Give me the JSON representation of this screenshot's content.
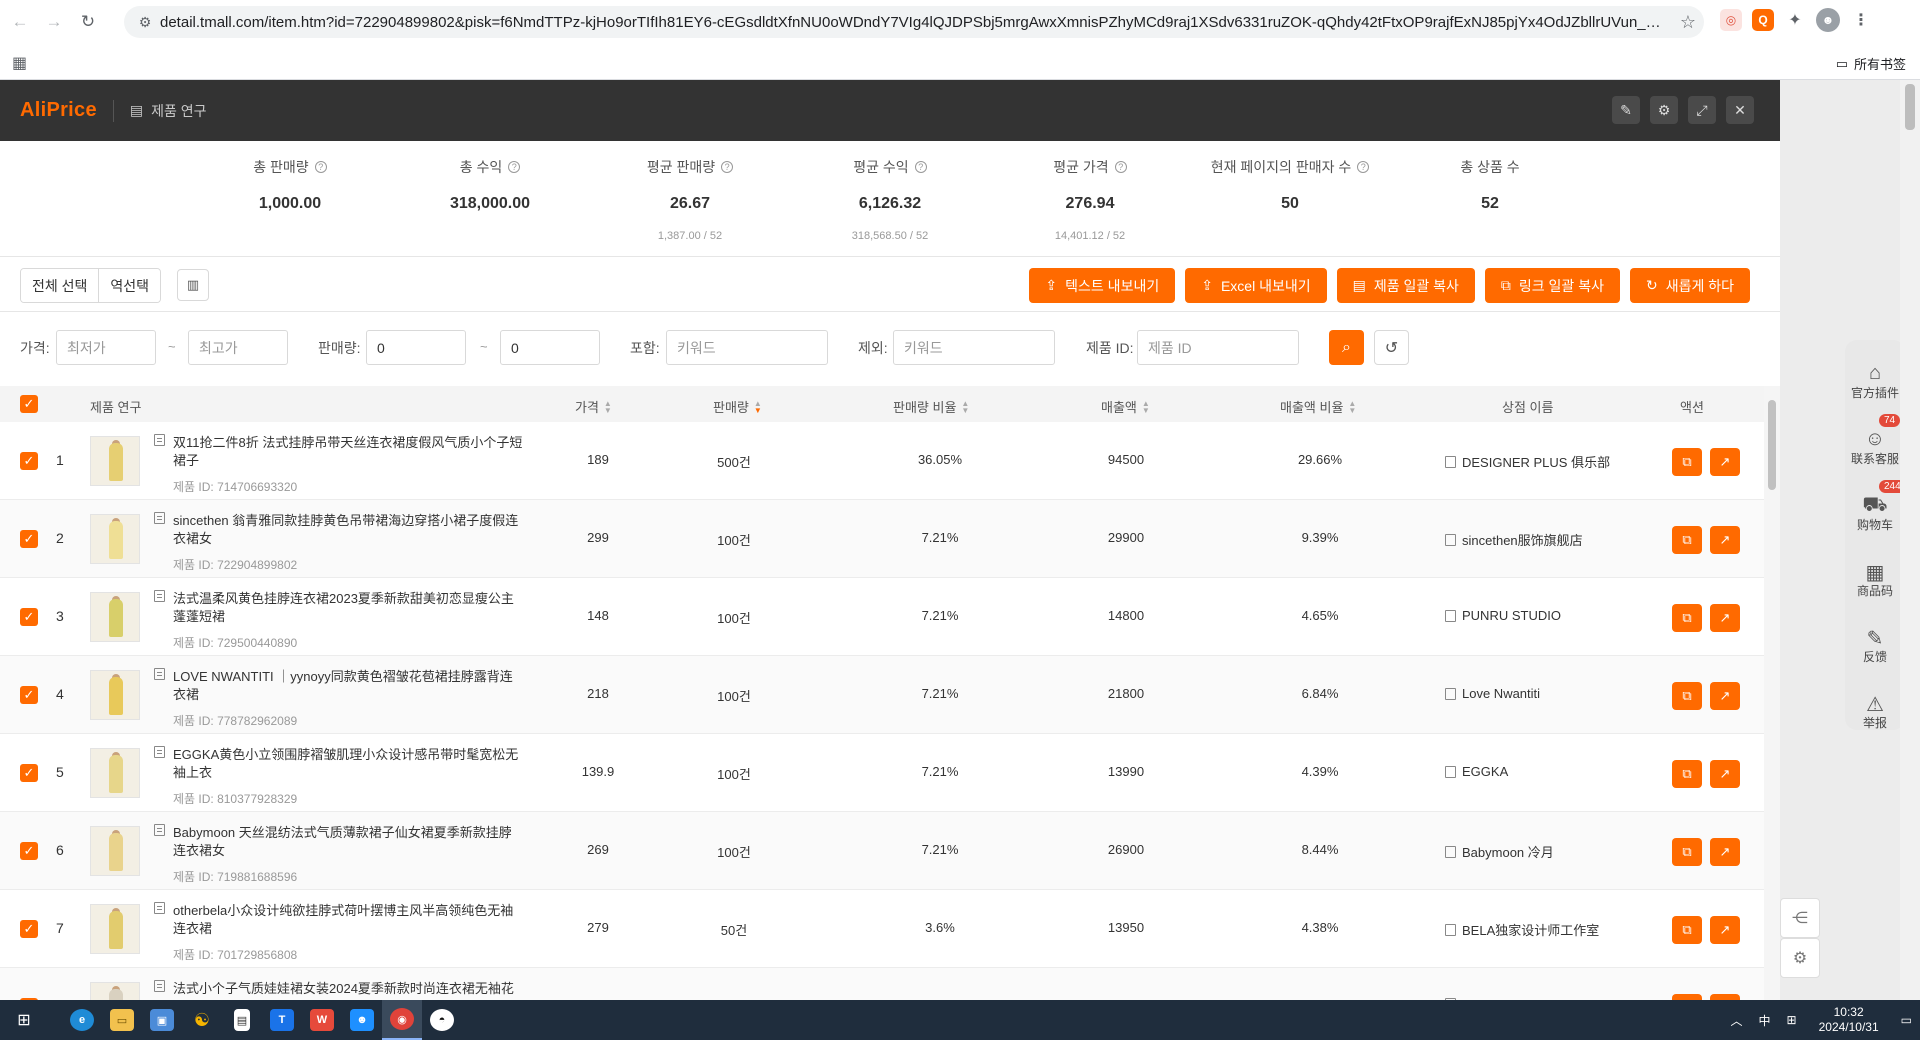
{
  "browser": {
    "url": "detail.tmall.com/item.htm?id=722904899802&pisk=f6NmdTTPz-kjHo9orTIfIh81EY6-cEGsdldtXfnNU0oWDndY7VIg4lQJDPSbj5mrgAwxXmnisPZhyMCd9raj1XSdv6331ruZOK-qQhdy42tFtxOP9rajfExNJ85pjYx4OdJZbllrUVun_Vo...",
    "bookmarks_all": "所有书签"
  },
  "plugin": {
    "logo": "AliPrice",
    "title": "제품 연구"
  },
  "stats": [
    {
      "label": "총 판매량",
      "value": "1,000.00",
      "sub": ""
    },
    {
      "label": "총 수익",
      "value": "318,000.00",
      "sub": ""
    },
    {
      "label": "평균 판매량",
      "value": "26.67",
      "sub": "1,387.00 / 52"
    },
    {
      "label": "평균 수익",
      "value": "6,126.32",
      "sub": "318,568.50 / 52"
    },
    {
      "label": "평균 가격",
      "value": "276.94",
      "sub": "14,401.12 / 52"
    },
    {
      "label": "현재 페이지의 판매자 수",
      "value": "50",
      "sub": ""
    },
    {
      "label": "총 상품 수",
      "value": "52",
      "sub": ""
    }
  ],
  "actions": {
    "select_all": "전체 선택",
    "invert": "역선택",
    "export_text": "텍스트 내보내기",
    "export_excel": "Excel 내보내기",
    "copy_products": "제품 일괄 복사",
    "copy_links": "링크 일괄 복사",
    "refresh": "새롭게 하다"
  },
  "filters": {
    "price_label": "가격:",
    "price_min": "최저가",
    "price_max": "최고가",
    "sales_label": "판매량:",
    "sales_min": "0",
    "sales_max": "0",
    "include_label": "포함:",
    "include_ph": "키워드",
    "exclude_label": "제외:",
    "exclude_ph": "키워드",
    "pid_label": "제품 ID:",
    "pid_ph": "제품 ID",
    "tilde": "~"
  },
  "table": {
    "headers": {
      "product": "제품 연구",
      "price": "가격",
      "sales": "판매량",
      "sales_ratio": "판매량 비율",
      "revenue": "매출액",
      "revenue_ratio": "매출액 비율",
      "shop": "상점 이름",
      "action": "액션"
    },
    "id_prefix": "제품 ID: ",
    "rows": [
      {
        "no": "1",
        "name": "双11抢二件8折 法式挂脖吊带天丝连衣裙度假风气质小个子短裙子",
        "pid": "제품 ID: 714706693320",
        "price": "189",
        "sales": "500건",
        "sales_ratio": "36.05%",
        "revenue": "94500",
        "revenue_ratio": "29.66%",
        "shop": "DESIGNER PLUS 俱乐部",
        "color": "#e6cf72"
      },
      {
        "no": "2",
        "name": "sincethen 翁青雅同款挂脖黄色吊带裙海边穿搭小裙子度假连衣裙女",
        "pid": "제품 ID: 722904899802",
        "price": "299",
        "sales": "100건",
        "sales_ratio": "7.21%",
        "revenue": "29900",
        "revenue_ratio": "9.39%",
        "shop": "sincethen服饰旗舰店",
        "color": "#efdf95"
      },
      {
        "no": "3",
        "name": "法式温柔风黄色挂脖连衣裙2023夏季新款甜美初恋显瘦公主蓬蓬短裙",
        "pid": "제품 ID: 729500440890",
        "price": "148",
        "sales": "100건",
        "sales_ratio": "7.21%",
        "revenue": "14800",
        "revenue_ratio": "4.65%",
        "shop": "PUNRU STUDIO",
        "color": "#d8cf6a"
      },
      {
        "no": "4",
        "name": "LOVE NWANTITI ｜yynoyy同款黄色褶皱花苞裙挂脖露背连衣裙",
        "pid": "제품 ID: 778782962089",
        "price": "218",
        "sales": "100건",
        "sales_ratio": "7.21%",
        "revenue": "21800",
        "revenue_ratio": "6.84%",
        "shop": "Love Nwantiti",
        "color": "#e8c95a"
      },
      {
        "no": "5",
        "name": "EGGKA黄色小立领围脖褶皱肌理小众设计感吊带时髦宽松无袖上衣",
        "pid": "제품 ID: 810377928329",
        "price": "139.9",
        "sales": "100건",
        "sales_ratio": "7.21%",
        "revenue": "13990",
        "revenue_ratio": "4.39%",
        "shop": "EGGKA",
        "color": "#e7d68a"
      },
      {
        "no": "6",
        "name": "Babymoon 天丝混纺法式气质薄款裙子仙女裙夏季新款挂脖连衣裙女",
        "pid": "제품 ID: 719881688596",
        "price": "269",
        "sales": "100건",
        "sales_ratio": "7.21%",
        "revenue": "26900",
        "revenue_ratio": "8.44%",
        "shop": "Babymoon 冷月",
        "color": "#e9d38c"
      },
      {
        "no": "7",
        "name": "otherbela小众设计纯欲挂脖式荷叶摆博主风半高领纯色无袖连衣裙",
        "pid": "제품 ID: 701729856808",
        "price": "279",
        "sales": "50건",
        "sales_ratio": "3.6%",
        "revenue": "13950",
        "revenue_ratio": "4.38%",
        "shop": "BELA独家设计师工作室",
        "color": "#e2cc6e"
      },
      {
        "no": "8",
        "name": "法式小个子气质娃娃裙女装2024夏季新款时尚连衣裙无袖花",
        "pid": "",
        "price": "",
        "sales": "",
        "sales_ratio": "",
        "revenue": "",
        "revenue_ratio": "",
        "shop": "",
        "color": "#d9d1c0"
      }
    ]
  },
  "sidebar_tools": [
    {
      "label": "官方插件",
      "icon": "plugin-icon",
      "badge": ""
    },
    {
      "label": "联系客服",
      "icon": "service-icon",
      "badge": "74"
    },
    {
      "label": "购物车",
      "icon": "cart-icon",
      "badge": "244"
    },
    {
      "label": "商品码",
      "icon": "grid-icon",
      "badge": ""
    },
    {
      "label": "反馈",
      "icon": "edit-icon",
      "badge": ""
    },
    {
      "label": "举报",
      "icon": "warning-icon",
      "badge": ""
    }
  ],
  "taskbar": {
    "ime": "中",
    "time": "10:32",
    "date": "2024/10/31"
  },
  "colors": {
    "accent": "#ff6a00",
    "header_bg": "#333333"
  }
}
